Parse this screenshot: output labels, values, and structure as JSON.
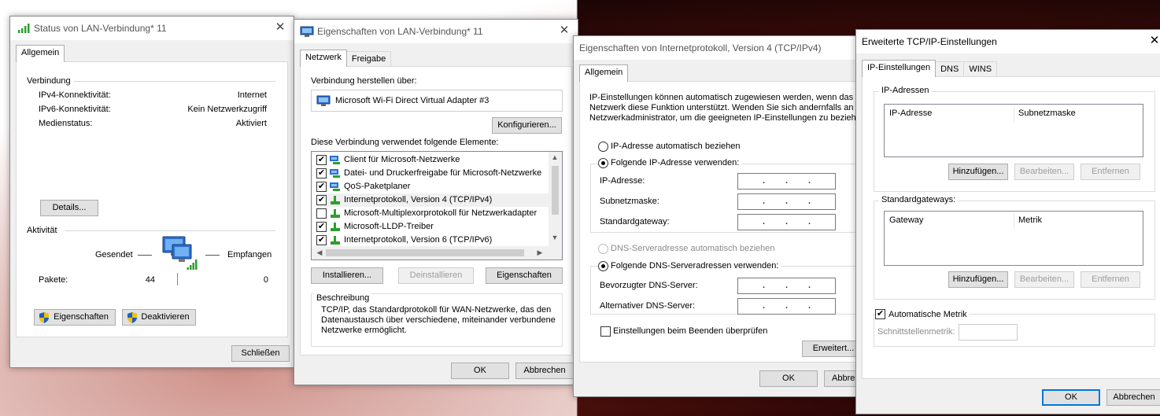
{
  "status_window": {
    "title": "Status von LAN-Verbindung* 11",
    "tab": "Allgemein",
    "connection_header": "Verbindung",
    "rows": [
      {
        "label": "IPv4-Konnektivität:",
        "value": "Internet"
      },
      {
        "label": "IPv6-Konnektivität:",
        "value": "Kein Netzwerkzugriff"
      },
      {
        "label": "Medienstatus:",
        "value": "Aktiviert"
      }
    ],
    "details_button": "Details...",
    "activity_header": "Aktivität",
    "sent_label": "Gesendet",
    "received_label": "Empfangen",
    "packets_label": "Pakete:",
    "packets_sent": "44",
    "packets_received": "0",
    "properties_button": "Eigenschaften",
    "disable_button": "Deaktivieren",
    "close_button": "Schließen"
  },
  "properties_window": {
    "title": "Eigenschaften von LAN-Verbindung* 11",
    "tabs": [
      "Netzwerk",
      "Freigabe"
    ],
    "connect_via_label": "Verbindung herstellen über:",
    "adapter_name": "Microsoft Wi-Fi Direct Virtual Adapter #3",
    "configure_button": "Konfigurieren...",
    "elements_label": "Diese Verbindung verwendet folgende Elemente:",
    "items": [
      {
        "label": "Client für Microsoft-Netzwerke",
        "checked": true
      },
      {
        "label": "Datei- und Druckerfreigabe für Microsoft-Netzwerke",
        "checked": true
      },
      {
        "label": "QoS-Paketplaner",
        "checked": true
      },
      {
        "label": "Internetprotokoll, Version 4 (TCP/IPv4)",
        "checked": true
      },
      {
        "label": "Microsoft-Multiplexorprotokoll für Netzwerkadapter",
        "checked": false
      },
      {
        "label": "Microsoft-LLDP-Treiber",
        "checked": true
      },
      {
        "label": "Internetprotokoll, Version 6 (TCP/IPv6)",
        "checked": true
      }
    ],
    "install_button": "Installieren...",
    "uninstall_button": "Deinstallieren",
    "properties_button": "Eigenschaften",
    "description_header": "Beschreibung",
    "description_text": "TCP/IP, das Standardprotokoll für WAN-Netzwerke, das den Datenaustausch über verschiedene, miteinander verbundene Netzwerke ermöglicht.",
    "ok_button": "OK",
    "cancel_button": "Abbrechen"
  },
  "ipv4_window": {
    "title": "Eigenschaften von Internetprotokoll, Version 4 (TCP/IPv4)",
    "tab": "Allgemein",
    "intro_line1": "IP-Einstellungen können automatisch zugewiesen werden, wenn das",
    "intro_line2": "Netzwerk diese Funktion unterstützt. Wenden Sie sich andernfalls an d",
    "intro_line3": "Netzwerkadministrator, um die geeigneten IP-Einstellungen zu beziehe",
    "auto_ip": "IP-Adresse automatisch beziehen",
    "manual_ip": "Folgende IP-Adresse verwenden:",
    "ip_address_label": "IP-Adresse:",
    "subnet_label": "Subnetzmaske:",
    "gateway_label": "Standardgateway:",
    "auto_dns": "DNS-Serveradresse automatisch beziehen",
    "manual_dns": "Folgende DNS-Serveradressen verwenden:",
    "preferred_dns_label": "Bevorzugter DNS-Server:",
    "alternate_dns_label": "Alternativer DNS-Server:",
    "validate_label": "Einstellungen beim Beenden überprüfen",
    "advanced_button": "Erweitert...",
    "ok_button": "OK",
    "cancel_button": "Abbre"
  },
  "advanced_window": {
    "title": "Erweiterte TCP/IP-Einstellungen",
    "tabs": [
      "IP-Einstellungen",
      "DNS",
      "WINS"
    ],
    "ip_group": "IP-Adressen",
    "ip_col1": "IP-Adresse",
    "ip_col2": "Subnetzmaske",
    "gw_group": "Standardgateways:",
    "gw_col1": "Gateway",
    "gw_col2": "Metrik",
    "add_button": "Hinzufügen...",
    "edit_button": "Bearbeiten...",
    "remove_button": "Entfernen",
    "auto_metric": "Automatische Metrik",
    "interface_metric": "Schnittstellenmetrik:",
    "ok_button": "OK",
    "cancel_button": "Abbrechen"
  },
  "colors": {
    "accent": "#0078d7",
    "window_bg": "#f0f0f0",
    "panel_bg": "#ffffff"
  }
}
